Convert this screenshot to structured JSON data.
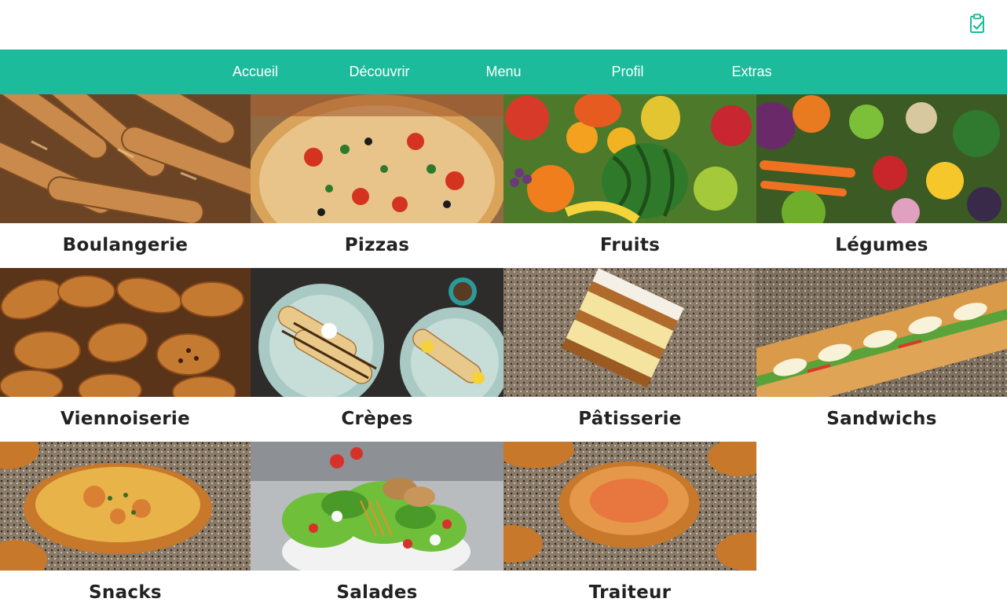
{
  "header": {
    "order_icon": "clipboard-check-icon"
  },
  "nav": {
    "items": [
      "Accueil",
      "Découvrir",
      "Menu",
      "Profil",
      "Extras"
    ]
  },
  "colors": {
    "nav_bg": "#1cbb9b",
    "accent_icon": "#1cbb9b",
    "label_text": "#222222"
  },
  "categories": [
    {
      "label": "Boulangerie",
      "image": "baguettes-photo"
    },
    {
      "label": "Pizzas",
      "image": "pizza-photo"
    },
    {
      "label": "Fruits",
      "image": "fruits-photo"
    },
    {
      "label": "Légumes",
      "image": "vegetables-photo"
    },
    {
      "label": "Viennoiserie",
      "image": "croissants-photo"
    },
    {
      "label": "Crèpes",
      "image": "crepes-photo"
    },
    {
      "label": "Pâtisserie",
      "image": "mille-feuille-photo"
    },
    {
      "label": "Sandwichs",
      "image": "sandwich-photo"
    },
    {
      "label": "Snacks",
      "image": "quiche-photo"
    },
    {
      "label": "Salades",
      "image": "salad-photo"
    },
    {
      "label": "Traiteur",
      "image": "tart-photo"
    }
  ]
}
